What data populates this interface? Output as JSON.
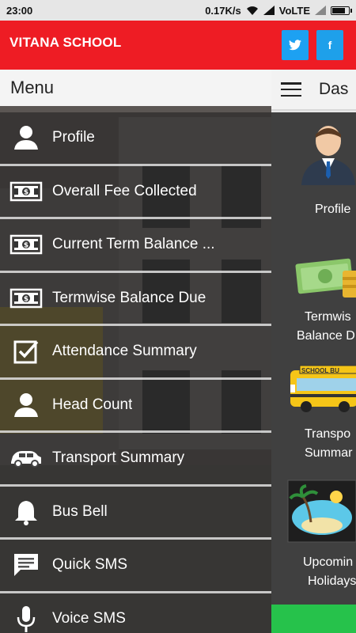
{
  "status_bar": {
    "time": "23:00",
    "speed": "0.17K/s",
    "network": "VoLTE",
    "battery_level": 0.85
  },
  "app_bar": {
    "title": "VITANA SCHOOL",
    "twitter_label": "t",
    "facebook_label": "f"
  },
  "dashboard": {
    "title": "Das",
    "tiles": [
      {
        "label_line1": "Profile",
        "label_line2": ""
      },
      {
        "label_line1": "Termwis",
        "label_line2": "Balance D"
      },
      {
        "label_line1": "Transpo",
        "label_line2": "Summar"
      },
      {
        "label_line1": "Upcomin",
        "label_line2": "Holidays"
      }
    ],
    "bus_sign": "SCHOOL BU"
  },
  "drawer": {
    "title": "Menu",
    "items": [
      {
        "label": "Profile",
        "icon": "person-icon"
      },
      {
        "label": "Overall Fee Collected",
        "icon": "money-icon"
      },
      {
        "label": "Current Term Balance ...",
        "icon": "money-icon"
      },
      {
        "label": "Termwise Balance Due",
        "icon": "money-icon"
      },
      {
        "label": "Attendance Summary",
        "icon": "checkbox-icon"
      },
      {
        "label": "Head Count",
        "icon": "person-icon"
      },
      {
        "label": "Transport Summary",
        "icon": "car-icon"
      },
      {
        "label": "Bus Bell",
        "icon": "bell-icon"
      },
      {
        "label": "Quick SMS",
        "icon": "chat-icon"
      },
      {
        "label": "Voice SMS",
        "icon": "mic-icon"
      }
    ]
  }
}
